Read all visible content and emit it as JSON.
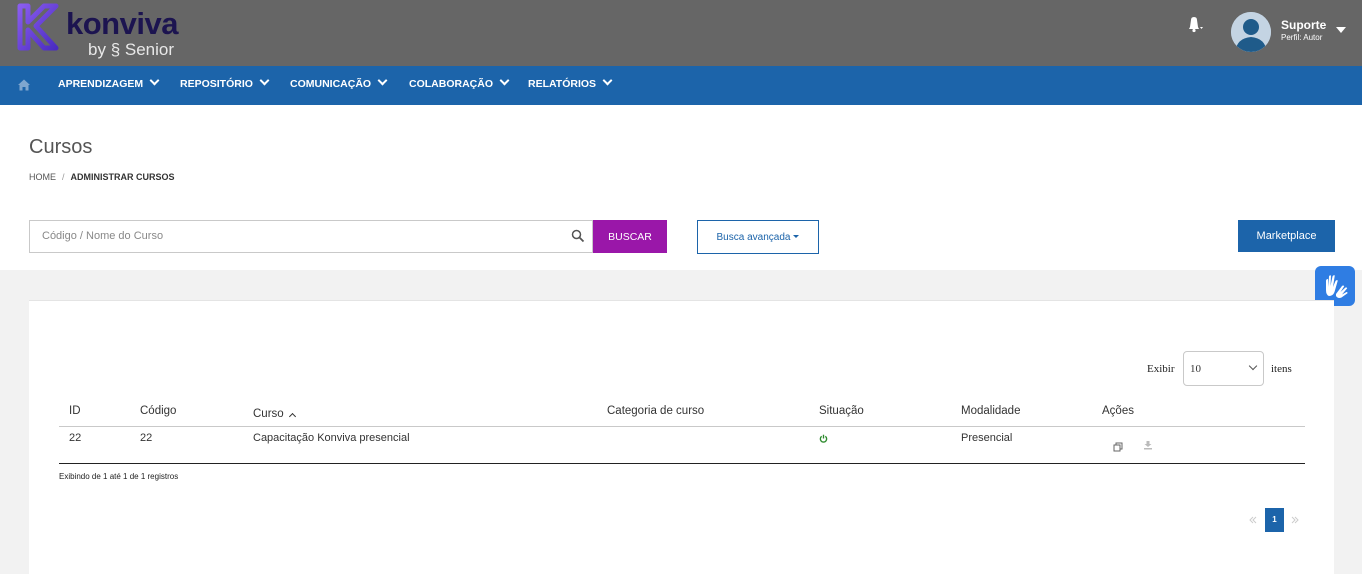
{
  "brand": {
    "name": "konviva",
    "by": "by",
    "partner": "Senior"
  },
  "user": {
    "name": "Suporte",
    "role": "Perfil: Autor"
  },
  "nav": {
    "items": [
      {
        "label": "APRENDIZAGEM"
      },
      {
        "label": "REPOSITÓRIO"
      },
      {
        "label": "COMUNICAÇÃO"
      },
      {
        "label": "COLABORAÇÃO"
      },
      {
        "label": "RELATÓRIOS"
      }
    ]
  },
  "page": {
    "title": "Cursos",
    "breadcrumb": {
      "home": "HOME",
      "separator": "/",
      "current": "ADMINISTRAR CURSOS"
    }
  },
  "search": {
    "placeholder": "Código / Nome do Curso",
    "value": "",
    "button": "BUSCAR",
    "advanced": "Busca avançada",
    "marketplace": "Marketplace"
  },
  "table": {
    "show_label": "Exibir",
    "page_size": "10",
    "items_label": "itens",
    "headers": {
      "id": "ID",
      "code": "Código",
      "course": "Curso",
      "category": "Categoria de curso",
      "status": "Situação",
      "mode": "Modalidade",
      "actions": "Ações"
    },
    "rows": [
      {
        "id": "22",
        "code": "22",
        "course": "Capacitação Konviva presencial",
        "category": "",
        "status": "power-icon",
        "mode": "Presencial"
      }
    ],
    "info": "Exibindo de 1 até 1 de 1 registros",
    "current_page": "1"
  },
  "colors": {
    "topbar": "#666666",
    "navbar": "#1c64aa",
    "buscar": "#9a17a9",
    "status_active": "#2e8b2e"
  }
}
